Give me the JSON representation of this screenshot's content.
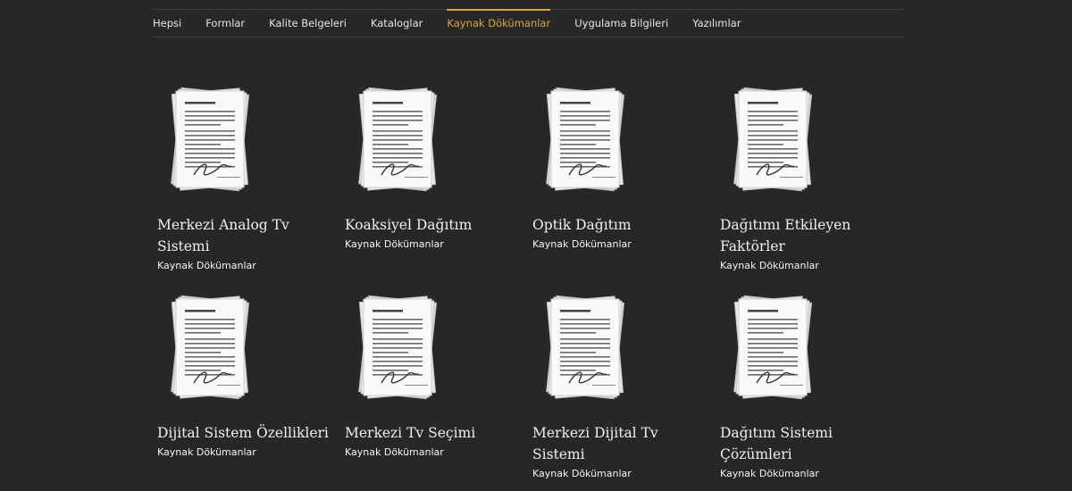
{
  "filters": [
    {
      "label": "Hepsi",
      "active": false
    },
    {
      "label": "Formlar",
      "active": false
    },
    {
      "label": "Kalite Belgeleri",
      "active": false
    },
    {
      "label": "Kataloglar",
      "active": false
    },
    {
      "label": "Kaynak Dökümanlar",
      "active": true
    },
    {
      "label": "Uygulama Bilgileri",
      "active": false
    },
    {
      "label": "Yazılımlar",
      "active": false
    }
  ],
  "colors": {
    "accent": "#e2a43a",
    "background": "#272727"
  },
  "items": [
    {
      "title": "Merkezi Analog Tv Sistemi",
      "category": "Kaynak Dökümanlar",
      "icon": "document-stack-icon"
    },
    {
      "title": "Koaksiyel Dağıtım",
      "category": "Kaynak Dökümanlar",
      "icon": "document-stack-icon"
    },
    {
      "title": "Optik Dağıtım",
      "category": "Kaynak Dökümanlar",
      "icon": "document-stack-icon"
    },
    {
      "title": "Dağıtımı Etkileyen Faktörler",
      "category": "Kaynak Dökümanlar",
      "icon": "document-stack-icon"
    },
    {
      "title": "Dijital Sistem Özellikleri",
      "category": "Kaynak Dökümanlar",
      "icon": "document-stack-icon"
    },
    {
      "title": "Merkezi Tv Seçimi",
      "category": "Kaynak Dökümanlar",
      "icon": "document-stack-icon"
    },
    {
      "title": "Merkezi Dijital Tv Sistemi",
      "category": "Kaynak Dökümanlar",
      "icon": "document-stack-icon"
    },
    {
      "title": "Dağıtım Sistemi Çözümleri",
      "category": "Kaynak Dökümanlar",
      "icon": "document-stack-icon"
    }
  ]
}
